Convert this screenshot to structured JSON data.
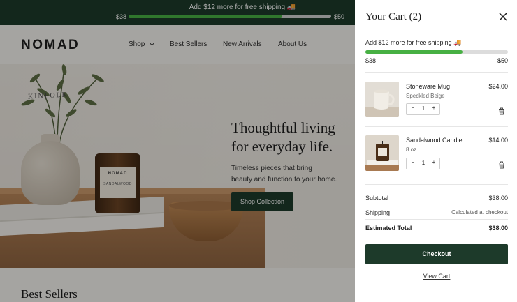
{
  "announcement": {
    "message": "Add $12 more for free shipping 🚚",
    "min_label": "$38",
    "max_label": "$50",
    "progress_fraction": 0.76
  },
  "nav": {
    "logo": "NOMAD",
    "links": [
      "Shop",
      "Best Sellers",
      "New Arrivals",
      "About Us"
    ]
  },
  "hero": {
    "title_line1": "Thoughtful living",
    "title_line2": "for everyday life.",
    "subtitle_line1": "Timeless pieces that bring",
    "subtitle_line2": "beauty and function to your home.",
    "cta": "Shop Collection",
    "book_title": "KINFOLK",
    "candle_brand": "NOMAD",
    "candle_scent": "SANDALWOOD"
  },
  "best_sellers_title": "Best Sellers",
  "cart": {
    "title": "Your Cart (2)",
    "shipping_message": "Add $12 more for free shipping 🚚",
    "progress_min": "$38",
    "progress_max": "$50",
    "progress_fraction": 0.68,
    "items": [
      {
        "name": "Stoneware Mug",
        "variant": "Speckled Beige",
        "price": "$24.00",
        "quantity": "1"
      },
      {
        "name": "Sandalwood Candle",
        "variant": "8 oz",
        "price": "$14.00",
        "quantity": "1"
      }
    ],
    "subtotal_label": "Subtotal",
    "subtotal_value": "$38.00",
    "shipping_label": "Shipping",
    "shipping_value": "Calculated at checkout",
    "total_label": "Estimated Total",
    "total_value": "$38.00",
    "checkout_label": "Checkout",
    "view_cart_label": "View Cart"
  },
  "colors": {
    "brand_green": "#1d3a2a",
    "progress_green": "#47b043"
  }
}
